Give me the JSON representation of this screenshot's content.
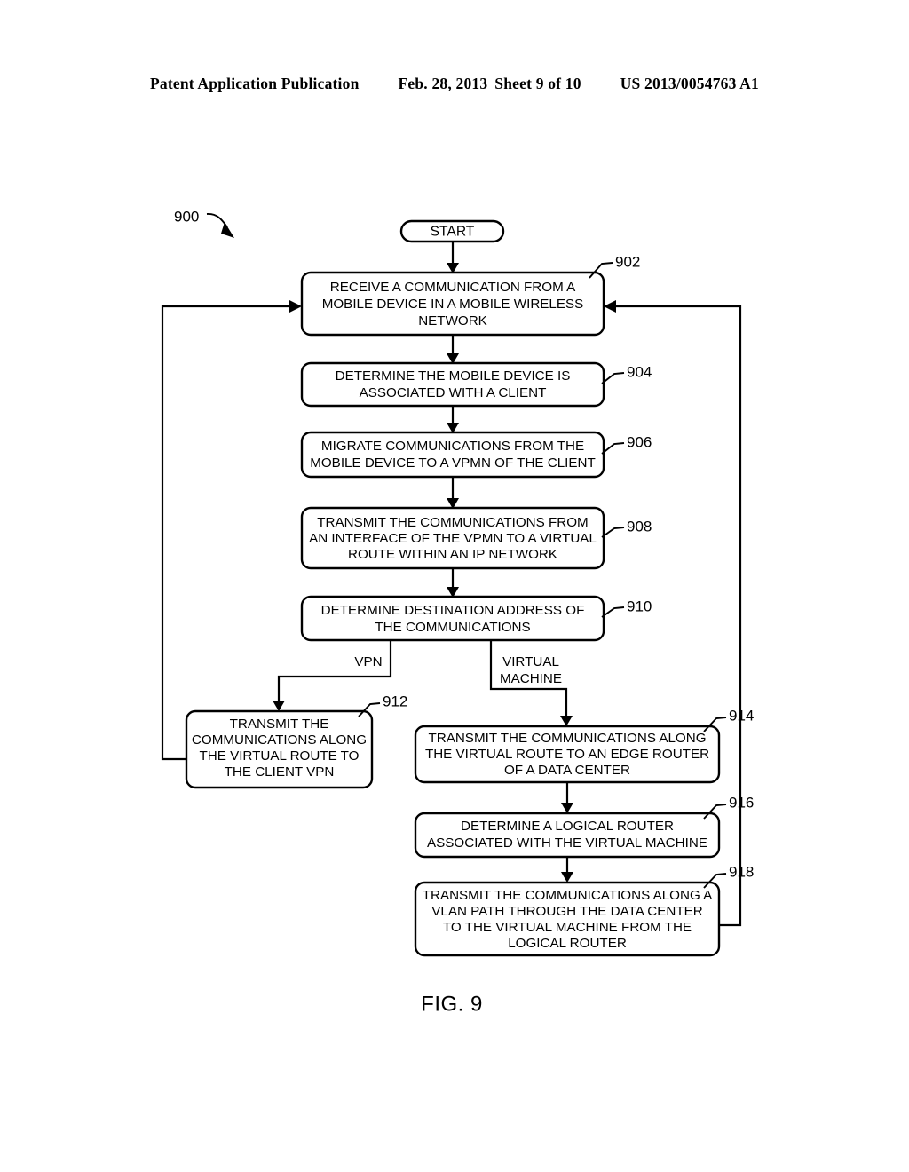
{
  "header": {
    "publication": "Patent Application Publication",
    "date": "Feb. 28, 2013",
    "sheet": "Sheet 9 of 10",
    "patent_number": "US 2013/0054763 A1"
  },
  "figure": {
    "caption": "FIG. 9",
    "diagram_ref": "900",
    "start_label": "START",
    "branch_labels": {
      "left": "VPN",
      "right": "VIRTUAL MACHINE",
      "right_line1": "VIRTUAL",
      "right_line2": "MACHINE"
    },
    "steps": [
      {
        "ref": "902",
        "lines": [
          "RECEIVE A COMMUNICATION FROM A",
          "MOBILE DEVICE IN A MOBILE WIRELESS",
          "NETWORK"
        ]
      },
      {
        "ref": "904",
        "lines": [
          "DETERMINE THE MOBILE DEVICE IS",
          "ASSOCIATED WITH A CLIENT"
        ]
      },
      {
        "ref": "906",
        "lines": [
          "MIGRATE COMMUNICATIONS FROM THE",
          "MOBILE DEVICE TO A VPMN OF THE CLIENT"
        ]
      },
      {
        "ref": "908",
        "lines": [
          "TRANSMIT THE COMMUNICATIONS FROM",
          "AN INTERFACE OF THE VPMN TO A VIRTUAL",
          "ROUTE WITHIN AN IP NETWORK"
        ]
      },
      {
        "ref": "910",
        "lines": [
          "DETERMINE DESTINATION ADDRESS OF",
          "THE COMMUNICATIONS"
        ]
      },
      {
        "ref": "912",
        "lines": [
          "TRANSMIT THE",
          "COMMUNICATIONS ALONG",
          "THE VIRTUAL ROUTE TO",
          "THE CLIENT VPN"
        ]
      },
      {
        "ref": "914",
        "lines": [
          "TRANSMIT THE COMMUNICATIONS ALONG",
          "THE VIRTUAL ROUTE TO AN EDGE ROUTER",
          "OF A DATA CENTER"
        ]
      },
      {
        "ref": "916",
        "lines": [
          "DETERMINE A LOGICAL ROUTER",
          "ASSOCIATED WITH THE VIRTUAL MACHINE"
        ]
      },
      {
        "ref": "918",
        "lines": [
          "TRANSMIT THE COMMUNICATIONS ALONG A",
          "VLAN PATH THROUGH THE DATA CENTER",
          "TO THE VIRTUAL MACHINE FROM THE",
          "LOGICAL ROUTER"
        ]
      }
    ]
  },
  "colors": {
    "ink": "#000000",
    "paper": "#ffffff"
  }
}
